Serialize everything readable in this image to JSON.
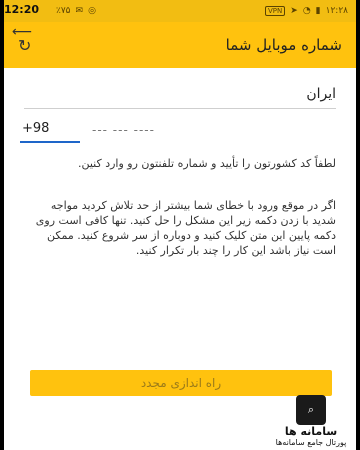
{
  "overlay_time": "12:20",
  "statusbar": {
    "left_text": "٪۷۵",
    "vpn": "VPN",
    "right_time": "۱۲:۲۸"
  },
  "appbar": {
    "title": "شماره موبایل شما"
  },
  "form": {
    "country": "ایران",
    "code": "+98",
    "phone_placeholder": "--- --- ----"
  },
  "hint1": "لطفاً کد کشورتون را تأیید و شماره تلفنتون رو وارد کنین.",
  "hint2": "اگر در موقع ورود با خطای شما بیشتر از حد تلاش کردید مواجه شدید با زدن دکمه زیر این مشکل را حل کنید. تنها کافی است روی دکمه پایین این متن کلیک کنید و دوباره از سر شروع کنید. ممکن است نیاز باشد این کار را چند بار تکرار کنید.",
  "retry_label": "راه اندازی مجدد",
  "watermark": {
    "name": "سامانه ها",
    "tagline": "پورتال جامع سامانه‌ها"
  }
}
